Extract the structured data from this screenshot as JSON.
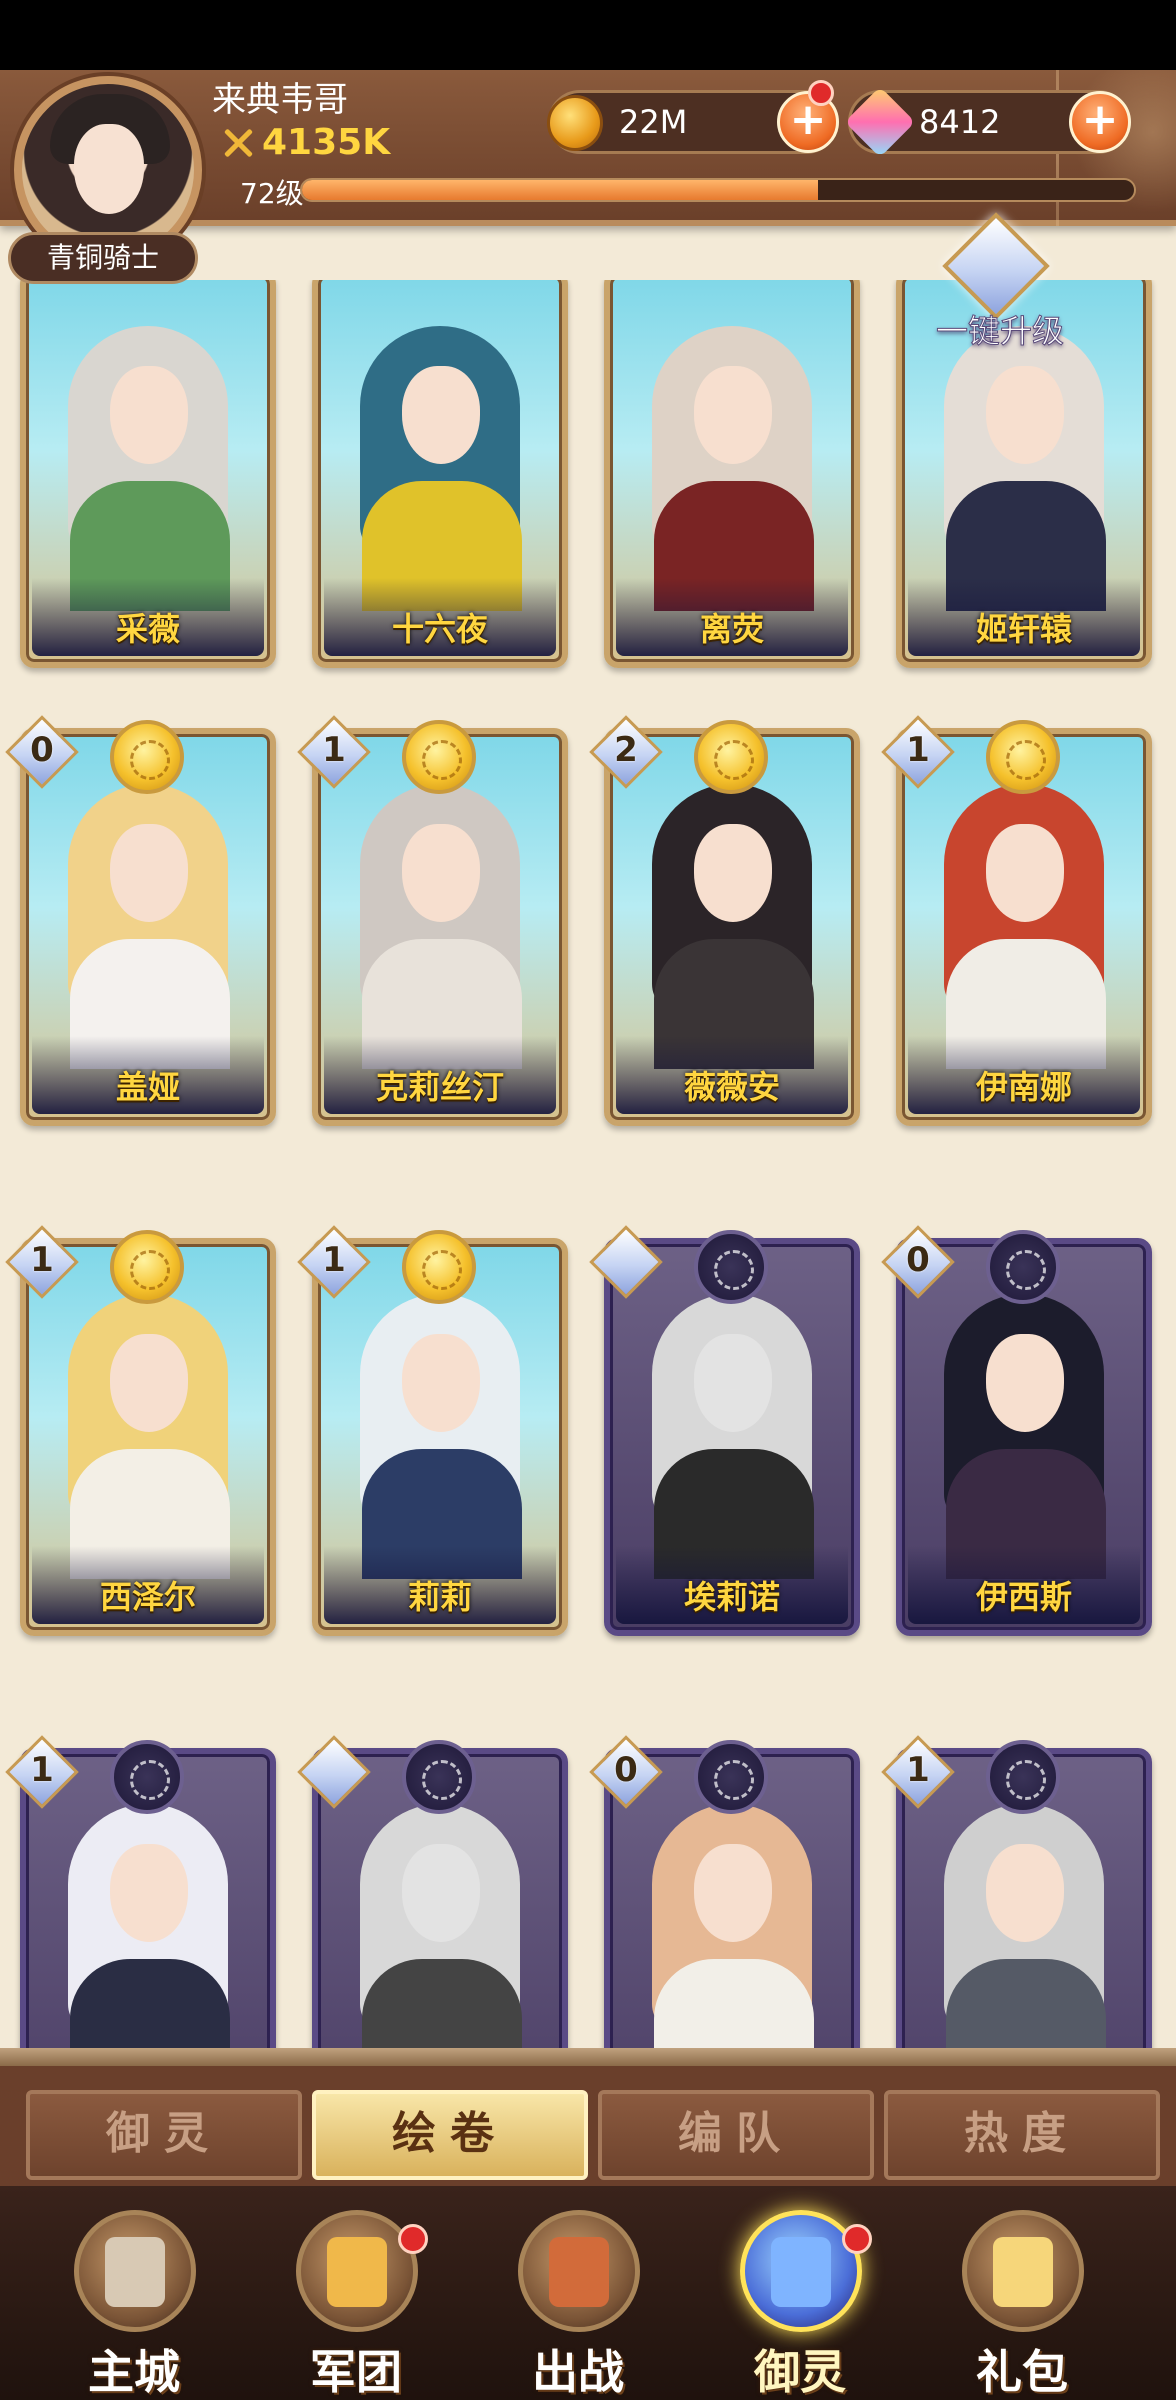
{
  "player": {
    "name": "来典韦哥",
    "power": "4135K",
    "level": "72级",
    "xp_fraction": 0.62,
    "rank": "青铜骑士"
  },
  "resources": {
    "gold": "22M",
    "gems": "8412",
    "add_symbol": "+"
  },
  "upgrade_all_label": "一键升级",
  "cards": [
    {
      "name": "采薇",
      "style": "gold",
      "badge": null,
      "hair": "#d9d6d0",
      "body": "#5e9a5a",
      "grayed": false
    },
    {
      "name": "十六夜",
      "style": "gold",
      "badge": null,
      "hair": "#2f6d86",
      "body": "#e0c22a",
      "grayed": false
    },
    {
      "name": "离荧",
      "style": "gold",
      "badge": null,
      "hair": "#ded2c6",
      "body": "#7a2424",
      "grayed": false
    },
    {
      "name": "姬轩辕",
      "style": "gold",
      "badge": null,
      "hair": "#e4ddd6",
      "body": "#2b2e48",
      "grayed": false
    },
    {
      "name": "盖娅",
      "style": "gold",
      "badge": "0",
      "hair": "#f1d28a",
      "body": "#f4f1ee",
      "grayed": false
    },
    {
      "name": "克莉丝汀",
      "style": "gold",
      "badge": "1",
      "hair": "#cfc8c2",
      "body": "#e8e2da",
      "grayed": false
    },
    {
      "name": "薇薇安",
      "style": "gold",
      "badge": "2",
      "hair": "#2b2428",
      "body": "#3a3436",
      "grayed": false
    },
    {
      "name": "伊南娜",
      "style": "gold",
      "badge": "1",
      "hair": "#c8452e",
      "body": "#f0ede6",
      "grayed": false
    },
    {
      "name": "西泽尔",
      "style": "gold",
      "badge": "1",
      "hair": "#f0d27a",
      "body": "#f3efe6",
      "grayed": false
    },
    {
      "name": "莉莉",
      "style": "gold",
      "badge": "1",
      "hair": "#e8eef2",
      "body": "#2c3d66",
      "grayed": false
    },
    {
      "name": "埃莉诺",
      "style": "dark",
      "badge": "",
      "hair": "#d8d8d8",
      "body": "#2a2a2a",
      "grayed": true
    },
    {
      "name": "伊西斯",
      "style": "dark",
      "badge": "0",
      "hair": "#1c1c2c",
      "body": "#3a2a44",
      "grayed": false
    },
    {
      "name": "",
      "style": "dark",
      "badge": "1",
      "hair": "#ececf4",
      "body": "#2a2d44",
      "grayed": false
    },
    {
      "name": "",
      "style": "dark",
      "badge": "",
      "hair": "#d8d8d8",
      "body": "#444",
      "grayed": true
    },
    {
      "name": "",
      "style": "dark",
      "badge": "0",
      "hair": "#e6b894",
      "body": "#f2efe8",
      "grayed": false
    },
    {
      "name": "",
      "style": "dark",
      "badge": "1",
      "hair": "#cfcfcf",
      "body": "#555a66",
      "grayed": false
    }
  ],
  "tabs": [
    {
      "label": "御灵",
      "active": false
    },
    {
      "label": "绘卷",
      "active": true
    },
    {
      "label": "编队",
      "active": false
    },
    {
      "label": "热度",
      "active": false
    }
  ],
  "nav": [
    {
      "label": "主城",
      "active": false,
      "dot": false,
      "icon": "city-icon"
    },
    {
      "label": "军团",
      "active": false,
      "dot": true,
      "icon": "legion-fist-icon"
    },
    {
      "label": "出战",
      "active": false,
      "dot": false,
      "icon": "battle-gate-icon"
    },
    {
      "label": "御灵",
      "active": true,
      "dot": true,
      "icon": "spirit-crystal-icon"
    },
    {
      "label": "礼包",
      "active": false,
      "dot": false,
      "icon": "gift-shop-icon"
    }
  ]
}
